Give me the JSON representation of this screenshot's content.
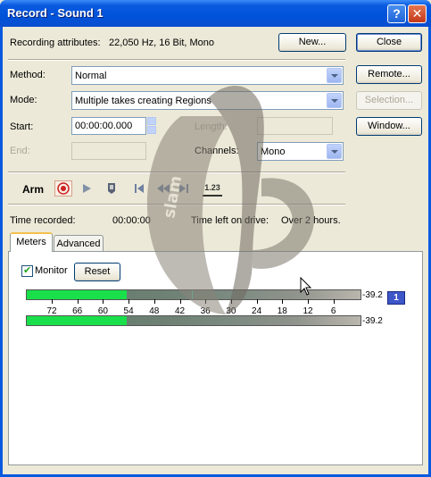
{
  "window": {
    "title": "Record - Sound 1",
    "help_label": "?",
    "close_label": "✕"
  },
  "attributes": {
    "label": "Recording attributes:",
    "value": "22,050 Hz, 16 Bit, Mono"
  },
  "buttons": {
    "new": "New...",
    "close": "Close",
    "remote": "Remote...",
    "selection": "Selection...",
    "window": "Window...",
    "reset": "Reset"
  },
  "method": {
    "label": "Method:",
    "value": "Normal"
  },
  "mode": {
    "label": "Mode:",
    "value": "Multiple takes creating Regions"
  },
  "start": {
    "label": "Start:",
    "value": "00:00:00.000"
  },
  "end": {
    "label": "End:",
    "value": ""
  },
  "length": {
    "label": "Length:",
    "value": ""
  },
  "channels": {
    "label": "Channels:",
    "value": "Mono"
  },
  "transport": {
    "arm_label": "Arm",
    "counter_label": "1.23"
  },
  "status": {
    "time_recorded_label": "Time recorded:",
    "time_recorded_value": "00:00:00",
    "time_left_label": "Time left on drive:",
    "time_left_value": "Over 2 hours."
  },
  "tabs": [
    {
      "label": "Meters"
    },
    {
      "label": "Advanced"
    }
  ],
  "meters": {
    "monitor_label": "Monitor",
    "monitor_checked": true,
    "scale": [
      "72",
      "66",
      "60",
      "54",
      "48",
      "42",
      "36",
      "30",
      "24",
      "18",
      "12",
      "6"
    ],
    "channel_1_value": "-39.2",
    "channel_2_value": "-39.2",
    "channel_badge": "1",
    "level_fraction": 0.3
  },
  "colors": {
    "accent": "#0a5ae0",
    "meter_green": "#19e04a",
    "badge": "#3d56c8"
  }
}
